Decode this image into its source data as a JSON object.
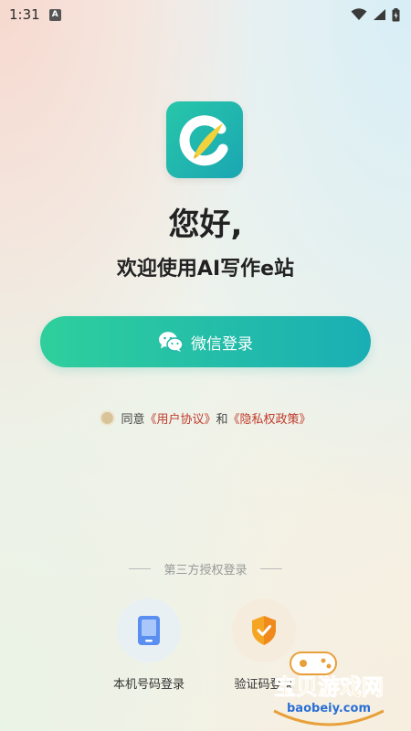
{
  "status": {
    "time": "1:31",
    "notif_badge": "A"
  },
  "greeting": "您好,",
  "welcome": "欢迎使用AI写作e站",
  "wechat_login": {
    "label": "微信登录",
    "icon": "wechat-icon"
  },
  "agreement": {
    "prefix": "同意",
    "user_agreement": "《用户协议》",
    "and": "和",
    "privacy_policy": "《隐私权政策》"
  },
  "third_party": {
    "title": "第三方授权登录",
    "options": [
      {
        "label": "本机号码登录",
        "icon": "phone-icon"
      },
      {
        "label": "验证码登录",
        "icon": "shield-check-icon"
      }
    ]
  },
  "watermark": {
    "text": "宝贝游戏网",
    "url": "baobeiy.com"
  },
  "colors": {
    "accent_start": "#2fcf9c",
    "accent_end": "#1aaeb4",
    "link": "#c0392b"
  }
}
